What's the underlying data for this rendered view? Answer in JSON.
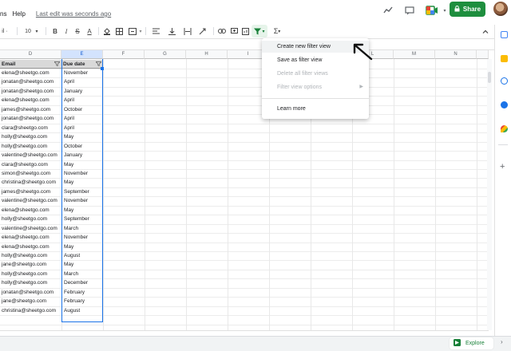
{
  "menu": {
    "items": [
      "ns",
      "Help"
    ],
    "last_edit": "Last edit was seconds ago"
  },
  "header": {
    "share_label": "Share"
  },
  "toolbar": {
    "zoom_fragment": "il ·",
    "font_size": "10",
    "bold": "B",
    "italic": "I",
    "strike": "S",
    "text_color": "A",
    "sigma": "Σ"
  },
  "columns": [
    "D",
    "E",
    "F",
    "G",
    "H",
    "I",
    "J",
    "K",
    "L",
    "M",
    "N"
  ],
  "table": {
    "headers": [
      "Email",
      "Due date"
    ],
    "rows": [
      [
        "elena@sheetgo.com",
        "November"
      ],
      [
        "jonatan@sheetgo.com",
        "April"
      ],
      [
        "jonatan@sheetgo.com",
        "January"
      ],
      [
        "elena@sheetgo.com",
        "April"
      ],
      [
        "james@sheetgo.com",
        "October"
      ],
      [
        "jonatan@sheetgo.com",
        "April"
      ],
      [
        "clara@sheetgo.com",
        "April"
      ],
      [
        "holly@sheetgo.com",
        "May"
      ],
      [
        "holly@sheetgo.com",
        "October"
      ],
      [
        "valentine@sheetgo.com",
        "January"
      ],
      [
        "clara@sheetgo.com",
        "May"
      ],
      [
        "simon@sheetgo.com",
        "November"
      ],
      [
        "christina@sheetgo.com",
        "May"
      ],
      [
        "james@sheetgo.com",
        "September"
      ],
      [
        "valentine@sheetgo.com",
        "November"
      ],
      [
        "elena@sheetgo.com",
        "May"
      ],
      [
        "holly@sheetgo.com",
        "September"
      ],
      [
        "valentine@sheetgo.com",
        "March"
      ],
      [
        "elena@sheetgo.com",
        "November"
      ],
      [
        "elena@sheetgo.com",
        "May"
      ],
      [
        "holly@sheetgo.com",
        "August"
      ],
      [
        "jane@sheetgo.com",
        "May"
      ],
      [
        "holly@sheetgo.com",
        "March"
      ],
      [
        "holly@sheetgo.com",
        "December"
      ],
      [
        "jonatan@sheetgo.com",
        "February"
      ],
      [
        "jane@sheetgo.com",
        "February"
      ],
      [
        "christina@sheetgo.com",
        "August"
      ]
    ]
  },
  "dropdown": {
    "items": [
      {
        "label": "Create new filter view",
        "state": "highlighted"
      },
      {
        "label": "Save as filter view",
        "state": "enabled"
      },
      {
        "label": "Delete all filter views",
        "state": "disabled"
      },
      {
        "label": "Filter view options",
        "state": "disabled",
        "submenu": true
      },
      {
        "label": "Learn more",
        "state": "enabled"
      }
    ]
  },
  "explore_label": "Explore",
  "colors": {
    "share_green": "#1e8e3e",
    "selection_blue": "#1a73e8",
    "header_gray": "#d9d9d9"
  },
  "icons": {
    "sidebar": [
      "sheets-icon",
      "keep-icon",
      "tasks-icon",
      "contacts-icon",
      "maps-icon",
      "add-icon"
    ]
  }
}
